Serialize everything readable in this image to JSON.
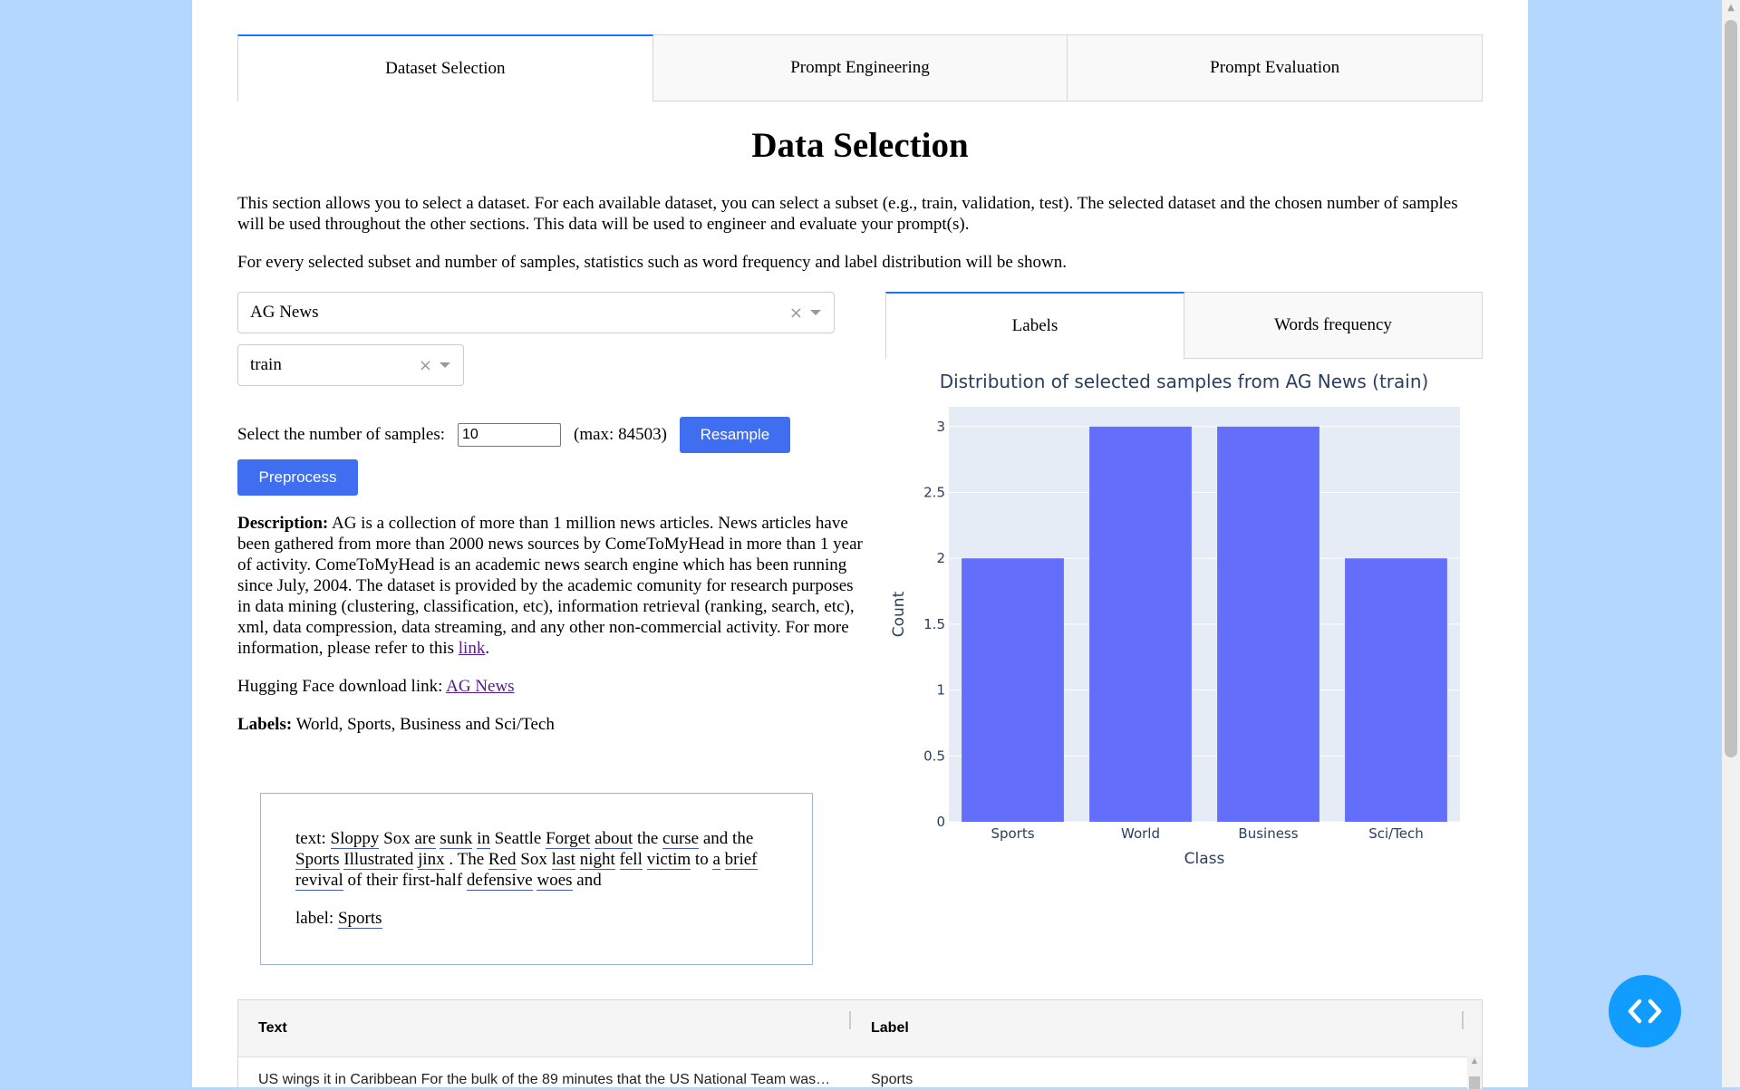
{
  "tabs": [
    "Dataset Selection",
    "Prompt Engineering",
    "Prompt Evaluation"
  ],
  "title": "Data Selection",
  "intro": {
    "p1": "This section allows you to select a dataset. For each available dataset, you can select a subset (e.g., train, validation, test). The selected dataset and the chosen number of samples will be used throughout the other sections. This data will be used to engineer and evaluate your prompt(s).",
    "p2": "For every selected subset and number of samples, statistics such as word frequency and label distribution will be shown."
  },
  "dataset_dropdown": {
    "value": "AG News"
  },
  "subset_dropdown": {
    "value": "train"
  },
  "samples": {
    "label": "Select the number of samples:",
    "value": "10",
    "max": "(max: 84503)",
    "resample_label": "Resample"
  },
  "preprocess_label": "Preprocess",
  "description": {
    "heading": "Description:",
    "text": " AG is a collection of more than 1 million news articles. News articles have been gathered from more than 2000 news sources by ComeToMyHead in more than 1 year of activity. ComeToMyHead is an academic news search engine which has been running since July, 2004. The dataset is provided by the academic comunity for research purposes in data mining (clustering, classification, etc), information retrieval (ranking, search, etc), xml, data compression, data streaming, and any other non-commercial activity. For more information, please refer to this ",
    "link": "link",
    "end": ".",
    "hf_label": "Hugging Face download link: ",
    "hf_link": "AG News",
    "labels_heading": "Labels:",
    "labels_text": " World, Sports, Business and Sci/Tech"
  },
  "sample": {
    "text_prefix": "text: ",
    "tokens": [
      {
        "t": "Sloppy",
        "u": true
      },
      {
        "t": "Sox",
        "u": false
      },
      {
        "t": "are",
        "u": true
      },
      {
        "t": "sunk",
        "u": true
      },
      {
        "t": "in",
        "u": true
      },
      {
        "t": "Seattle",
        "u": false
      },
      {
        "t": "Forget",
        "u": true
      },
      {
        "t": "about",
        "u": true
      },
      {
        "t": "the",
        "u": false
      },
      {
        "t": "curse",
        "u": true
      },
      {
        "t": "and",
        "u": false
      },
      {
        "t": "the",
        "u": false
      },
      {
        "t": "Sports",
        "u": true
      },
      {
        "t": "Illustrated",
        "u": true
      },
      {
        "t": "jinx",
        "u": true
      },
      {
        "t": ".",
        "u": false
      },
      {
        "t": "The",
        "u": false
      },
      {
        "t": "Red",
        "u": true
      },
      {
        "t": "Sox",
        "u": false
      },
      {
        "t": "last",
        "u": true
      },
      {
        "t": "night",
        "u": true
      },
      {
        "t": "fell",
        "u": true
      },
      {
        "t": "victim",
        "u": true
      },
      {
        "t": "to",
        "u": false
      },
      {
        "t": "a",
        "u": true
      },
      {
        "t": "brief",
        "u": true
      },
      {
        "t": "revival",
        "u": true
      },
      {
        "t": "of",
        "u": false
      },
      {
        "t": "their",
        "u": false
      },
      {
        "t": "first-half",
        "u": false
      },
      {
        "t": "defensive",
        "u": true
      },
      {
        "t": "woes",
        "u": true
      },
      {
        "t": "and",
        "u": false
      }
    ],
    "label_prefix": "label: ",
    "label_value": "Sports"
  },
  "right_tabs": [
    "Labels",
    "Words frequency"
  ],
  "chart_data": {
    "type": "bar",
    "title": "Distribution of selected samples from AG News (train)",
    "categories": [
      "Sports",
      "World",
      "Business",
      "Sci/Tech"
    ],
    "values": [
      2,
      3,
      3,
      2
    ],
    "xlabel": "Class",
    "ylabel": "Count",
    "ylim": [
      0,
      3.15
    ],
    "yticks": [
      0,
      0.5,
      1,
      1.5,
      2,
      2.5,
      3
    ],
    "bar_color": "#636efa",
    "plot_bg": "#e5ecf6",
    "grid": true
  },
  "table": {
    "headers": [
      "Text",
      "Label"
    ],
    "rows": [
      {
        "text": "US wings it in Caribbean For the bulk of the 89 minutes that the US National Team was on the field",
        "label": "Sports"
      }
    ]
  },
  "colors": {
    "page_bg": "#b3d7ff",
    "accent": "#1975fa",
    "button": "#3f6ef0",
    "fab": "#119dff"
  }
}
